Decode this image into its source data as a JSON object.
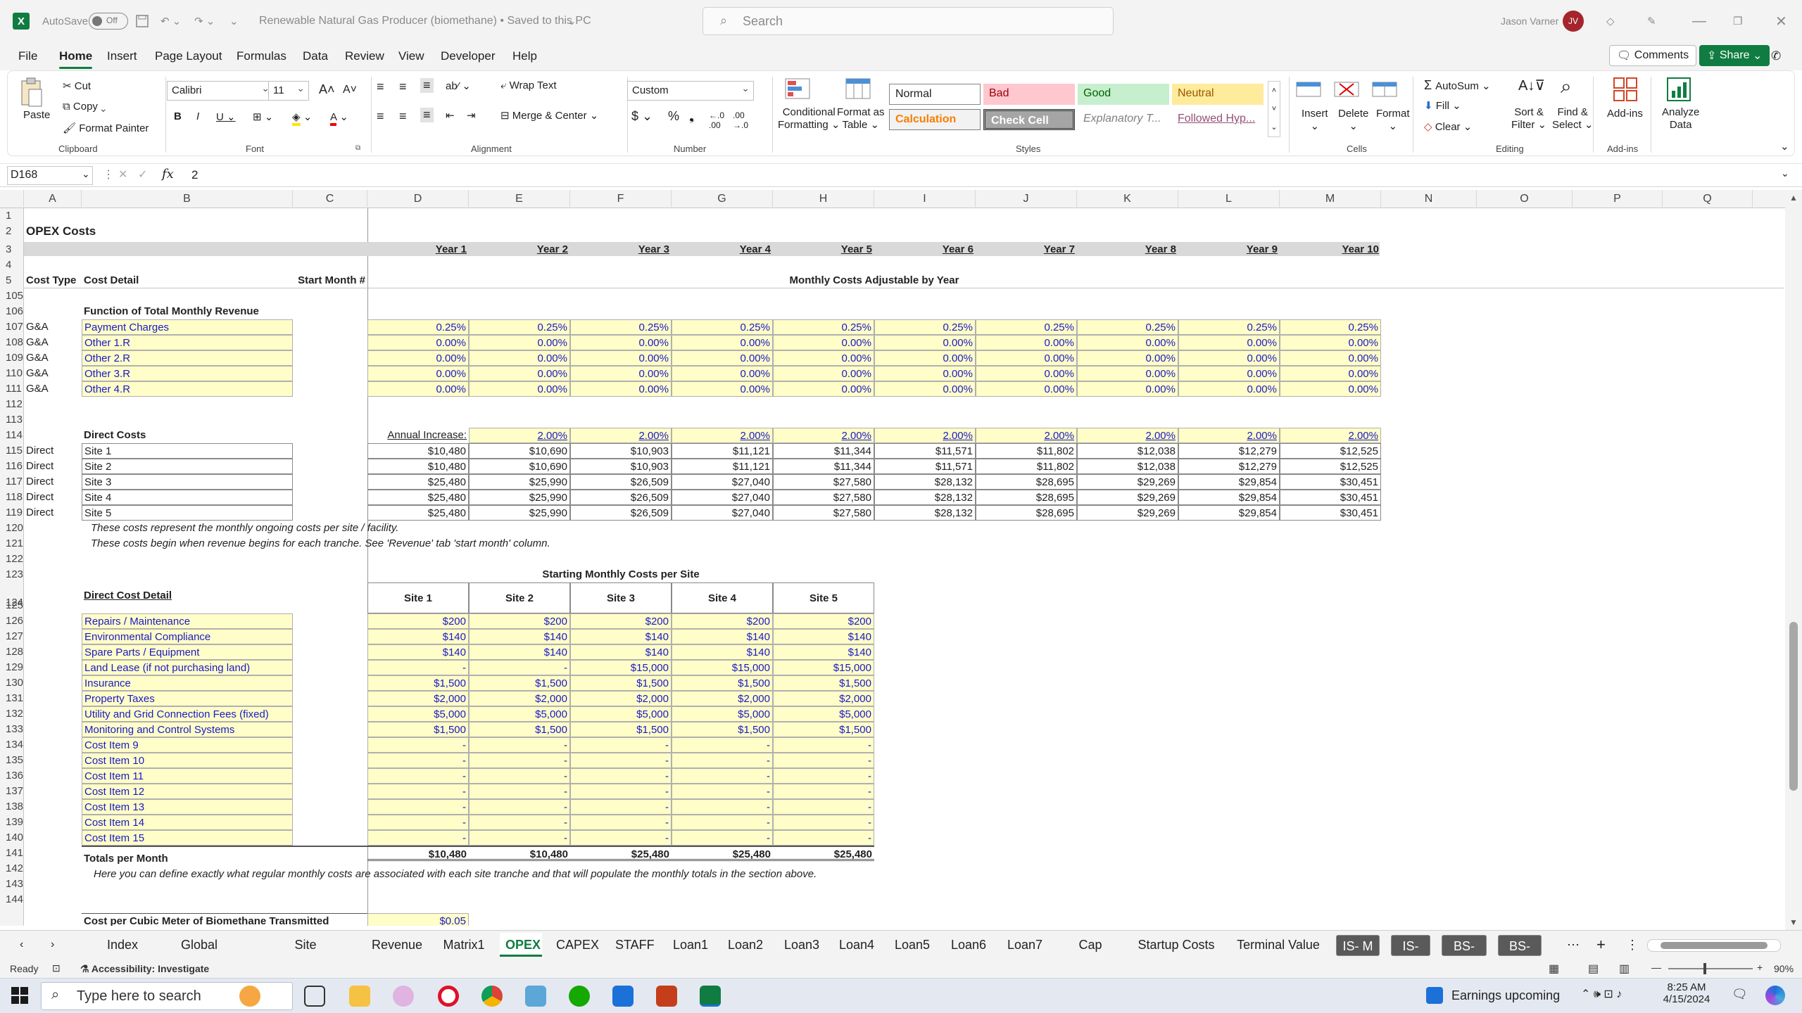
{
  "titlebar": {
    "autosave": "AutoSave",
    "autosave_state": "Off",
    "doc_title": "Renewable Natural Gas Producer (biomethane) • Saved to this PC",
    "search_placeholder": "Search",
    "user_name": "Jason Varner",
    "user_initials": "JV"
  },
  "menu": {
    "items": [
      "File",
      "Home",
      "Insert",
      "Page Layout",
      "Formulas",
      "Data",
      "Review",
      "View",
      "Developer",
      "Help"
    ],
    "active": "Home",
    "comments": "Comments",
    "share": "Share"
  },
  "ribbon": {
    "paste": "Paste",
    "cut": "Cut",
    "copy": "Copy",
    "format_painter": "Format Painter",
    "clipboard": "Clipboard",
    "font_name": "Calibri",
    "font_size": "11",
    "font": "Font",
    "wrap_text": "Wrap Text",
    "merge_center": "Merge & Center",
    "alignment": "Alignment",
    "number_format": "Custom",
    "number": "Number",
    "conditional_formatting": [
      "Conditional",
      "Formatting"
    ],
    "format_as_table": [
      "Format as",
      "Table"
    ],
    "styles": {
      "normal": "Normal",
      "bad": "Bad",
      "good": "Good",
      "neutral": "Neutral",
      "calculation": "Calculation",
      "check_cell": "Check Cell",
      "explanatory": "Explanatory T...",
      "followed": "Followed Hyp..."
    },
    "styles_label": "Styles",
    "insert": "Insert",
    "delete": "Delete",
    "format": "Format",
    "cells": "Cells",
    "autosum": "AutoSum",
    "fill": "Fill",
    "clear": "Clear",
    "sort_filter": [
      "Sort &",
      "Filter"
    ],
    "find_select": [
      "Find &",
      "Select"
    ],
    "editing": "Editing",
    "addins": "Add-ins",
    "analyze_data": [
      "Analyze",
      "Data"
    ],
    "addins_label": "Add-ins"
  },
  "formula_bar": {
    "cell_ref": "D168",
    "value": "2"
  },
  "columns": [
    "A",
    "B",
    "C",
    "D",
    "E",
    "F",
    "G",
    "H",
    "I",
    "J",
    "K",
    "L",
    "M",
    "N",
    "O",
    "P",
    "Q"
  ],
  "row_numbers": [
    "1",
    "2",
    "3",
    "4",
    "5",
    "105",
    "106",
    "107",
    "108",
    "109",
    "110",
    "111",
    "112",
    "113",
    "114",
    "115",
    "116",
    "117",
    "118",
    "119",
    "120",
    "121",
    "122",
    "123",
    "124",
    "125",
    "126",
    "127",
    "128",
    "129",
    "130",
    "131",
    "132",
    "133",
    "134",
    "135",
    "136",
    "137",
    "138",
    "139",
    "140",
    "141",
    "142",
    "143",
    "144"
  ],
  "sheet": {
    "title": "OPEX Costs",
    "years": [
      "Year 1",
      "Year 2",
      "Year 3",
      "Year 4",
      "Year 5",
      "Year 6",
      "Year 7",
      "Year 8",
      "Year 9",
      "Year 10"
    ],
    "h_cost_type": "Cost Type",
    "h_cost_detail": "Cost Detail",
    "h_start_month": "Start Month #",
    "h_monthly": "Monthly Costs Adjustable by Year",
    "fn_header": "Function of Total Monthly Revenue",
    "fn_rows": [
      {
        "type": "G&A",
        "name": "Payment Charges",
        "vals": [
          "0.25%",
          "0.25%",
          "0.25%",
          "0.25%",
          "0.25%",
          "0.25%",
          "0.25%",
          "0.25%",
          "0.25%",
          "0.25%"
        ]
      },
      {
        "type": "G&A",
        "name": "Other 1.R",
        "vals": [
          "0.00%",
          "0.00%",
          "0.00%",
          "0.00%",
          "0.00%",
          "0.00%",
          "0.00%",
          "0.00%",
          "0.00%",
          "0.00%"
        ]
      },
      {
        "type": "G&A",
        "name": "Other 2.R",
        "vals": [
          "0.00%",
          "0.00%",
          "0.00%",
          "0.00%",
          "0.00%",
          "0.00%",
          "0.00%",
          "0.00%",
          "0.00%",
          "0.00%"
        ]
      },
      {
        "type": "G&A",
        "name": "Other 3.R",
        "vals": [
          "0.00%",
          "0.00%",
          "0.00%",
          "0.00%",
          "0.00%",
          "0.00%",
          "0.00%",
          "0.00%",
          "0.00%",
          "0.00%"
        ]
      },
      {
        "type": "G&A",
        "name": "Other 4.R",
        "vals": [
          "0.00%",
          "0.00%",
          "0.00%",
          "0.00%",
          "0.00%",
          "0.00%",
          "0.00%",
          "0.00%",
          "0.00%",
          "0.00%"
        ]
      }
    ],
    "direct_header": "Direct Costs",
    "annual_increase_label": "Annual Increase:",
    "annual_increase": [
      "2.00%",
      "2.00%",
      "2.00%",
      "2.00%",
      "2.00%",
      "2.00%",
      "2.00%",
      "2.00%",
      "2.00%"
    ],
    "direct_rows": [
      {
        "type": "Direct",
        "name": "Site 1",
        "vals": [
          "$10,480",
          "$10,690",
          "$10,903",
          "$11,121",
          "$11,344",
          "$11,571",
          "$11,802",
          "$12,038",
          "$12,279",
          "$12,525"
        ]
      },
      {
        "type": "Direct",
        "name": "Site 2",
        "vals": [
          "$10,480",
          "$10,690",
          "$10,903",
          "$11,121",
          "$11,344",
          "$11,571",
          "$11,802",
          "$12,038",
          "$12,279",
          "$12,525"
        ]
      },
      {
        "type": "Direct",
        "name": "Site 3",
        "vals": [
          "$25,480",
          "$25,990",
          "$26,509",
          "$27,040",
          "$27,580",
          "$28,132",
          "$28,695",
          "$29,269",
          "$29,854",
          "$30,451"
        ]
      },
      {
        "type": "Direct",
        "name": "Site 4",
        "vals": [
          "$25,480",
          "$25,990",
          "$26,509",
          "$27,040",
          "$27,580",
          "$28,132",
          "$28,695",
          "$29,269",
          "$29,854",
          "$30,451"
        ]
      },
      {
        "type": "Direct",
        "name": "Site 5",
        "vals": [
          "$25,480",
          "$25,990",
          "$26,509",
          "$27,040",
          "$27,580",
          "$28,132",
          "$28,695",
          "$29,269",
          "$29,854",
          "$30,451"
        ]
      }
    ],
    "note1": "These costs represent the monthly ongoing costs per site / facility.",
    "note2": "These costs begin when revenue begins for each tranche. See 'Revenue' tab 'start month' column.",
    "starting_header": "Starting Monthly Costs per Site",
    "detail_header": "Direct Cost Detail",
    "sites": [
      "Site 1",
      "Site 2",
      "Site 3",
      "Site 4",
      "Site 5"
    ],
    "detail_rows": [
      {
        "name": "Repairs / Maintenance",
        "vals": [
          "$200",
          "$200",
          "$200",
          "$200",
          "$200"
        ]
      },
      {
        "name": "Environmental Compliance",
        "vals": [
          "$140",
          "$140",
          "$140",
          "$140",
          "$140"
        ]
      },
      {
        "name": "Spare Parts / Equipment",
        "vals": [
          "$140",
          "$140",
          "$140",
          "$140",
          "$140"
        ]
      },
      {
        "name": "Land Lease (if not purchasing land)",
        "vals": [
          "-",
          "-",
          "$15,000",
          "$15,000",
          "$15,000"
        ]
      },
      {
        "name": "Insurance",
        "vals": [
          "$1,500",
          "$1,500",
          "$1,500",
          "$1,500",
          "$1,500"
        ]
      },
      {
        "name": "Property Taxes",
        "vals": [
          "$2,000",
          "$2,000",
          "$2,000",
          "$2,000",
          "$2,000"
        ]
      },
      {
        "name": "Utility and Grid Connection Fees (fixed)",
        "vals": [
          "$5,000",
          "$5,000",
          "$5,000",
          "$5,000",
          "$5,000"
        ]
      },
      {
        "name": "Monitoring and Control Systems",
        "vals": [
          "$1,500",
          "$1,500",
          "$1,500",
          "$1,500",
          "$1,500"
        ]
      },
      {
        "name": "Cost Item 9",
        "vals": [
          "-",
          "-",
          "-",
          "-",
          "-"
        ]
      },
      {
        "name": "Cost Item 10",
        "vals": [
          "-",
          "-",
          "-",
          "-",
          "-"
        ]
      },
      {
        "name": "Cost Item 11",
        "vals": [
          "-",
          "-",
          "-",
          "-",
          "-"
        ]
      },
      {
        "name": "Cost Item 12",
        "vals": [
          "-",
          "-",
          "-",
          "-",
          "-"
        ]
      },
      {
        "name": "Cost Item 13",
        "vals": [
          "-",
          "-",
          "-",
          "-",
          "-"
        ]
      },
      {
        "name": "Cost Item 14",
        "vals": [
          "-",
          "-",
          "-",
          "-",
          "-"
        ]
      },
      {
        "name": "Cost Item 15",
        "vals": [
          "-",
          "-",
          "-",
          "-",
          "-"
        ]
      }
    ],
    "totals_label": "Totals per Month",
    "totals": [
      "$10,480",
      "$10,480",
      "$25,480",
      "$25,480",
      "$25,480"
    ],
    "note3": "Here you can define exactly what regular monthly costs are associated with each site tranche and that will populate the monthly totals in the section above.",
    "cubic_label": "Cost per Cubic Meter of Biomethane Transmitted",
    "cubic_value": "$0.05"
  },
  "tabs": {
    "items": [
      "Index",
      "Global Control",
      "Site Deployment",
      "Revenue",
      "Matrix1",
      "OPEX",
      "CAPEX",
      "STAFF",
      "Loan1",
      "Loan2",
      "Loan3",
      "Loan4",
      "Loan5",
      "Loan6",
      "Loan7",
      "Cap Table",
      "Startup Costs",
      "Terminal Value"
    ],
    "dark_items": [
      "IS- M",
      "IS- A",
      "BS- M",
      "BS- A"
    ],
    "active": "OPEX"
  },
  "status": {
    "ready": "Ready",
    "accessibility": "Accessibility: Investigate",
    "zoom": "90%"
  },
  "taskbar": {
    "search_placeholder": "Type here to search",
    "news": "Earnings upcoming",
    "time": "8:25 AM",
    "date": "4/15/2024"
  }
}
